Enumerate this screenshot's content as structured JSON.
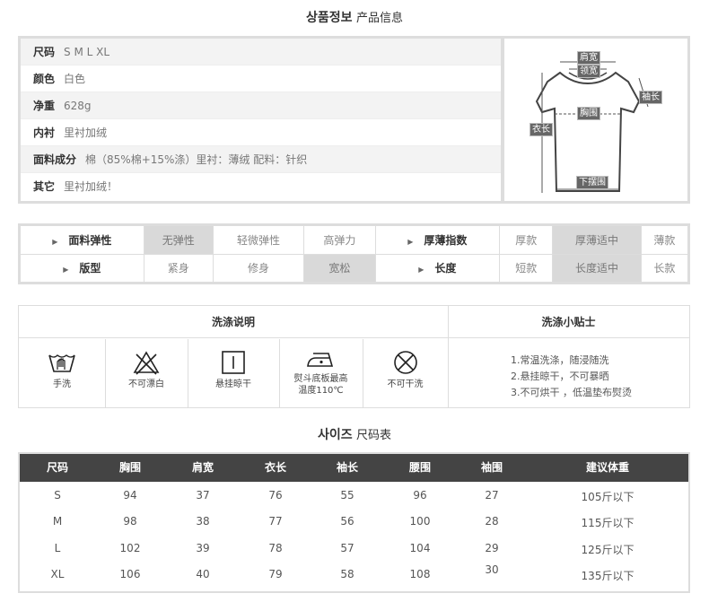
{
  "product_info": {
    "title_ko": "상품정보",
    "title_cn": "产品信息",
    "rows": [
      {
        "key": "尺码",
        "value": "S M L XL"
      },
      {
        "key": "颜色",
        "value": "白色"
      },
      {
        "key": "净重",
        "value": "628g"
      },
      {
        "key": "内衬",
        "value": "里衬加绒"
      },
      {
        "key": "面料成分",
        "value": "棉（85%棉+15%涤）里衬：薄绒 配料：针织"
      },
      {
        "key": "其它",
        "value": "里衬加绒！"
      }
    ],
    "diagram_labels": {
      "shoulder": "肩宽",
      "collar": "领宽",
      "sleeve": "袖长",
      "chest": "胸围",
      "length": "衣长",
      "hem": "下摆围"
    }
  },
  "attributes": {
    "row1": {
      "elasticity_label": "面料弹性",
      "elasticity_options": [
        "无弹性",
        "轻微弹性",
        "高弹力"
      ],
      "elasticity_selected": "无弹性",
      "thickness_label": "厚薄指数",
      "thickness_options": [
        "厚款",
        "厚薄适中",
        "薄款"
      ],
      "thickness_selected": "厚薄适中"
    },
    "row2": {
      "fit_label": "版型",
      "fit_options": [
        "紧身",
        "修身",
        "宽松"
      ],
      "fit_selected": "宽松",
      "length_label": "长度",
      "length_options": [
        "短款",
        "长度适中",
        "长款"
      ],
      "length_selected": "长度适中"
    }
  },
  "washing": {
    "title": "洗涤说明",
    "tips_title": "洗涤小贴士",
    "icons": [
      {
        "icon": "hand-wash-icon",
        "label": "手洗"
      },
      {
        "icon": "no-bleach-icon",
        "label": "不可漂白"
      },
      {
        "icon": "hang-dry-icon",
        "label": "悬挂晾干"
      },
      {
        "icon": "iron-low-icon",
        "label_line1": "熨斗底板最高",
        "label_line2": "温度110℃"
      },
      {
        "icon": "no-dry-clean-icon",
        "label": "不可干洗"
      }
    ],
    "tips": [
      "1.常温洗涤，随浸随洗",
      "2.悬挂晾干，不可暴晒",
      "3.不可烘干 ，低温垫布熨烫"
    ]
  },
  "size_chart": {
    "title_ko": "사이즈",
    "title_cn": "尺码表",
    "headers": [
      "尺码",
      "胸围",
      "肩宽",
      "衣长",
      "袖长",
      "腰围",
      "袖围",
      "建议体重"
    ],
    "rows": [
      [
        "S",
        "94",
        "37",
        "76",
        "55",
        "96",
        "27",
        "105斤以下"
      ],
      [
        "M",
        "98",
        "38",
        "77",
        "56",
        "100",
        "28",
        "115斤以下"
      ],
      [
        "L",
        "102",
        "39",
        "78",
        "57",
        "104",
        "29",
        "125斤以下"
      ],
      [
        "XL",
        "106",
        "40",
        "79",
        "58",
        "108",
        "30",
        "135斤以下"
      ]
    ]
  },
  "colors": {
    "header_dark": "#444444",
    "selected_cell": "#d9d9d9",
    "border": "#dddddd"
  }
}
